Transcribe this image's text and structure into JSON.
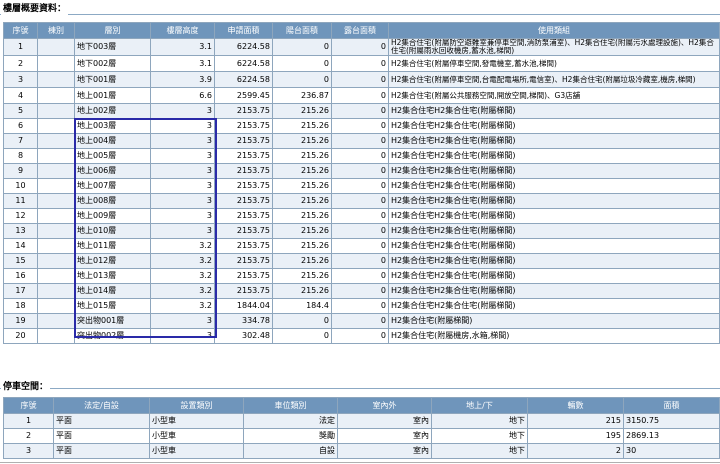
{
  "floor_section": {
    "title": "樓層概要資料：",
    "headers": [
      "序號",
      "棟別",
      "層別",
      "樓層高度",
      "申請面積",
      "陽台面積",
      "露台面積",
      "使用類組"
    ],
    "rows": [
      {
        "no": "1",
        "bldg": "",
        "floor": "地下003層",
        "height": "3.1",
        "area": "6224.58",
        "balcony": "0",
        "terrace": "0",
        "usage": "H2集合住宅(附屬防空避難室兼停車空間,消防泵浦室)、H2集合住宅(附屬污水處理設施)、H2集合住宅(附屬雨水回收機房,蓄水池,梯間)"
      },
      {
        "no": "2",
        "bldg": "",
        "floor": "地下002層",
        "height": "3.1",
        "area": "6224.58",
        "balcony": "0",
        "terrace": "0",
        "usage": "H2集合住宅(附屬停車空間,發電機室,蓄水池,梯間)"
      },
      {
        "no": "3",
        "bldg": "",
        "floor": "地下001層",
        "height": "3.9",
        "area": "6224.58",
        "balcony": "0",
        "terrace": "0",
        "usage": "H2集合住宅(附屬停車空間,台電配電場所,電信室)、H2集合住宅(附屬垃圾冷藏室,機房,梯間)"
      },
      {
        "no": "4",
        "bldg": "",
        "floor": "地上001層",
        "height": "6.6",
        "area": "2599.45",
        "balcony": "236.87",
        "terrace": "0",
        "usage": "H2集合住宅(附屬公共服務空間,開放空間,梯間)、G3店舖"
      },
      {
        "no": "5",
        "bldg": "",
        "floor": "地上002層",
        "height": "3",
        "area": "2153.75",
        "balcony": "215.26",
        "terrace": "0",
        "usage": "H2集合住宅H2集合住宅(附屬梯間)"
      },
      {
        "no": "6",
        "bldg": "",
        "floor": "地上003層",
        "height": "3",
        "area": "2153.75",
        "balcony": "215.26",
        "terrace": "0",
        "usage": "H2集合住宅H2集合住宅(附屬梯間)"
      },
      {
        "no": "7",
        "bldg": "",
        "floor": "地上004層",
        "height": "3",
        "area": "2153.75",
        "balcony": "215.26",
        "terrace": "0",
        "usage": "H2集合住宅H2集合住宅(附屬梯間)"
      },
      {
        "no": "8",
        "bldg": "",
        "floor": "地上005層",
        "height": "3",
        "area": "2153.75",
        "balcony": "215.26",
        "terrace": "0",
        "usage": "H2集合住宅H2集合住宅(附屬梯間)"
      },
      {
        "no": "9",
        "bldg": "",
        "floor": "地上006層",
        "height": "3",
        "area": "2153.75",
        "balcony": "215.26",
        "terrace": "0",
        "usage": "H2集合住宅H2集合住宅(附屬梯間)"
      },
      {
        "no": "10",
        "bldg": "",
        "floor": "地上007層",
        "height": "3",
        "area": "2153.75",
        "balcony": "215.26",
        "terrace": "0",
        "usage": "H2集合住宅H2集合住宅(附屬梯間)"
      },
      {
        "no": "11",
        "bldg": "",
        "floor": "地上008層",
        "height": "3",
        "area": "2153.75",
        "balcony": "215.26",
        "terrace": "0",
        "usage": "H2集合住宅H2集合住宅(附屬梯間)"
      },
      {
        "no": "12",
        "bldg": "",
        "floor": "地上009層",
        "height": "3",
        "area": "2153.75",
        "balcony": "215.26",
        "terrace": "0",
        "usage": "H2集合住宅H2集合住宅(附屬梯間)"
      },
      {
        "no": "13",
        "bldg": "",
        "floor": "地上010層",
        "height": "3",
        "area": "2153.75",
        "balcony": "215.26",
        "terrace": "0",
        "usage": "H2集合住宅H2集合住宅(附屬梯間)"
      },
      {
        "no": "14",
        "bldg": "",
        "floor": "地上011層",
        "height": "3.2",
        "area": "2153.75",
        "balcony": "215.26",
        "terrace": "0",
        "usage": "H2集合住宅H2集合住宅(附屬梯間)"
      },
      {
        "no": "15",
        "bldg": "",
        "floor": "地上012層",
        "height": "3.2",
        "area": "2153.75",
        "balcony": "215.26",
        "terrace": "0",
        "usage": "H2集合住宅H2集合住宅(附屬梯間)"
      },
      {
        "no": "16",
        "bldg": "",
        "floor": "地上013層",
        "height": "3.2",
        "area": "2153.75",
        "balcony": "215.26",
        "terrace": "0",
        "usage": "H2集合住宅H2集合住宅(附屬梯間)"
      },
      {
        "no": "17",
        "bldg": "",
        "floor": "地上014層",
        "height": "3.2",
        "area": "2153.75",
        "balcony": "215.26",
        "terrace": "0",
        "usage": "H2集合住宅H2集合住宅(附屬梯間)"
      },
      {
        "no": "18",
        "bldg": "",
        "floor": "地上015層",
        "height": "3.2",
        "area": "1844.04",
        "balcony": "184.4",
        "terrace": "0",
        "usage": "H2集合住宅H2集合住宅(附屬梯間)"
      },
      {
        "no": "19",
        "bldg": "",
        "floor": "突出物001層",
        "height": "3",
        "area": "334.78",
        "balcony": "0",
        "terrace": "0",
        "usage": "H2集合住宅(附屬梯間)"
      },
      {
        "no": "20",
        "bldg": "",
        "floor": "突出物002層",
        "height": "3",
        "area": "302.48",
        "balcony": "0",
        "terrace": "0",
        "usage": "H2集合住宅(附屬機房,水箱,梯間)"
      }
    ]
  },
  "parking_section": {
    "title": "停車空間：",
    "headers": [
      "序號",
      "法定/自設",
      "設置類別",
      "車位類別",
      "室內外",
      "地上/下",
      "輛數",
      "面積"
    ],
    "rows": [
      {
        "no": "1",
        "type": "平面",
        "category": "小型車",
        "spot": "法定",
        "inout": "室內",
        "level": "地下",
        "count": "215",
        "area": "3150.75"
      },
      {
        "no": "2",
        "type": "平面",
        "category": "小型車",
        "spot": "獎勵",
        "inout": "室內",
        "level": "地下",
        "count": "195",
        "area": "2869.13"
      },
      {
        "no": "3",
        "type": "平面",
        "category": "小型車",
        "spot": "自設",
        "inout": "室內",
        "level": "地下",
        "count": "2",
        "area": "30"
      }
    ]
  },
  "colors": {
    "header_bg": "#6f95bb",
    "row_alt_bg": "#eaf0f7",
    "highlight_border": "#2a2aa8"
  }
}
